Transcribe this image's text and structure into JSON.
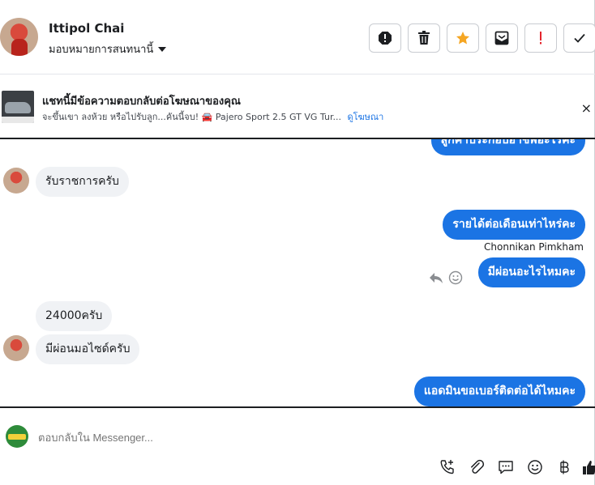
{
  "header": {
    "contact_name": "Ittipol Chai",
    "assign_label": "มอบหมายการสนทนานี้"
  },
  "ad": {
    "title": "แชทนี้มีข้อความตอบกลับต่อโฆษณาของคุณ",
    "snippet": "จะขึ้นเขา ลงห้วย หรือไปรับลูก...คันนี้จบ! 🚘 Pajero Sport 2.5 GT VG Tur...",
    "link": "ดูโฆษณา",
    "close": "×"
  },
  "messages": {
    "partial_out": "สูกค้าประกอบอาชีพอะไรคะ",
    "in_1": "รับราชการครับ",
    "out_1": "รายได้ต่อเดือนเท่าไหร่คะ",
    "sender": "Chonnikan Pimkham",
    "out_2": "มีผ่อนอะไรไหมคะ",
    "in_2": "24000ครับ",
    "in_3": "มีผ่อนมอไซด์ครับ",
    "out_3": "แอดมินขอเบอร์ติดต่อได้ไหมคะ"
  },
  "composer": {
    "placeholder": "ตอบกลับใน Messenger..."
  },
  "colors": {
    "accent": "#1b74e4",
    "star": "#f5a623",
    "important": "#e4242c"
  },
  "icons": [
    "alert-icon",
    "trash-icon",
    "star-icon",
    "archive-icon",
    "exclamation-icon",
    "check-icon",
    "reply-icon",
    "smile-icon",
    "phone-plus-icon",
    "paperclip-icon",
    "chat-icon",
    "emoji-icon",
    "baht-icon",
    "like-icon"
  ]
}
